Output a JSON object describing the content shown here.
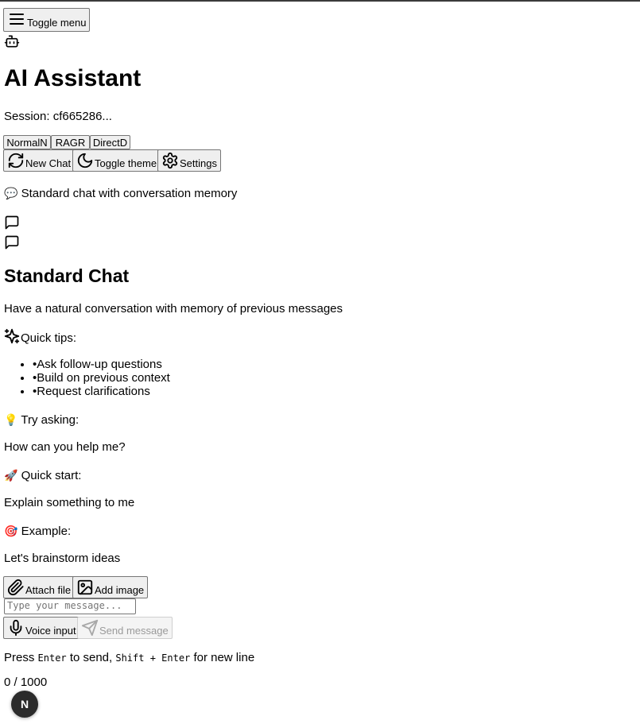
{
  "header": {
    "toggle_menu_label": "Toggle menu",
    "title": "AI Assistant",
    "session_text": "Session: cf665286..."
  },
  "modes": [
    {
      "label": "NormalN"
    },
    {
      "label": "RAGR"
    },
    {
      "label": "DirectD"
    }
  ],
  "toolbar": {
    "new_chat_label": "New Chat",
    "toggle_theme_label": "Toggle theme",
    "settings_label": "Settings"
  },
  "mode_description": {
    "emoji": "💬",
    "text": "Standard chat with conversation memory"
  },
  "chat_intro": {
    "heading": "Standard Chat",
    "description": "Have a natural conversation with memory of previous messages",
    "quick_tips_label": "Quick tips:",
    "tips": [
      "•Ask follow-up questions",
      "•Build on previous context",
      "•Request clarifications"
    ]
  },
  "suggestions": [
    {
      "emoji": "💡",
      "label": "Try asking:",
      "prompt": "How can you help me?"
    },
    {
      "emoji": "🚀",
      "label": "Quick start:",
      "prompt": "Explain something to me"
    },
    {
      "emoji": "🎯",
      "label": "Example:",
      "prompt": "Let's brainstorm ideas"
    }
  ],
  "composer": {
    "attach_file_label": "Attach file",
    "add_image_label": "Add image",
    "placeholder": "Type your message...",
    "voice_input_label": "Voice input",
    "send_label": "Send message",
    "hint_press": "Press",
    "hint_enter": "Enter",
    "hint_to_send": "to send,",
    "hint_shift_enter": "Shift + Enter",
    "hint_new_line": "for new line",
    "char_count": "0 / 1000"
  },
  "badge": {
    "letter": "N"
  }
}
